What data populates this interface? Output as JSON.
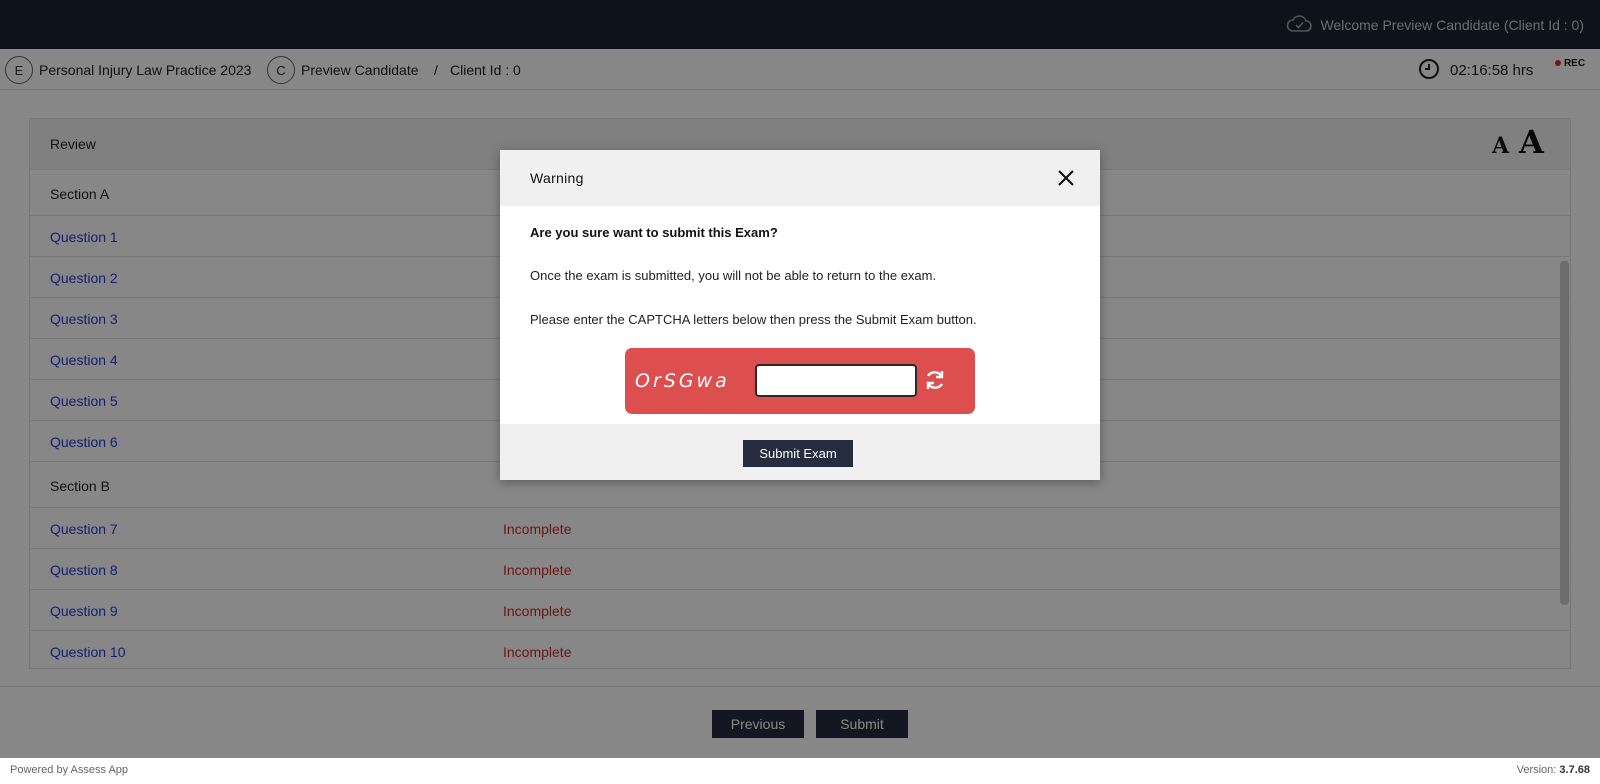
{
  "topbar": {
    "welcome": "Welcome Preview Candidate (Client Id : 0)"
  },
  "subbar": {
    "exam_badge": "E",
    "exam_name": "Personal Injury Law Practice 2023",
    "candidate_badge": "C",
    "candidate_name": "Preview Candidate",
    "separator": "/",
    "client_id": "Client Id : 0",
    "timer": "02:16:58 hrs",
    "rec_label": "REC"
  },
  "review": {
    "title": "Review",
    "font_small": "A",
    "font_large": "A",
    "rows": [
      {
        "type": "section",
        "label": "Section A"
      },
      {
        "type": "question",
        "label": "Question 1",
        "status": ""
      },
      {
        "type": "question",
        "label": "Question 2",
        "status": ""
      },
      {
        "type": "question",
        "label": "Question 3",
        "status": ""
      },
      {
        "type": "question",
        "label": "Question 4",
        "status": ""
      },
      {
        "type": "question",
        "label": "Question 5",
        "status": ""
      },
      {
        "type": "question",
        "label": "Question 6",
        "status": ""
      },
      {
        "type": "section",
        "label": "Section B"
      },
      {
        "type": "question",
        "label": "Question 7",
        "status": "Incomplete"
      },
      {
        "type": "question",
        "label": "Question 8",
        "status": "Incomplete"
      },
      {
        "type": "question",
        "label": "Question 9",
        "status": "Incomplete"
      },
      {
        "type": "question",
        "label": "Question 10",
        "status": "Incomplete"
      }
    ]
  },
  "nav": {
    "previous": "Previous",
    "submit": "Submit"
  },
  "footer": {
    "powered": "Powered by Assess App",
    "version_label": "Version:",
    "version": "3.7.68"
  },
  "modal": {
    "title": "Warning",
    "question": "Are you sure want to submit this Exam?",
    "info1": "Once the exam is submitted, you will not be able to return to the exam.",
    "info2": "Please enter the CAPTCHA letters below then press the Submit Exam button.",
    "captcha_code": "OrSGwa",
    "captcha_value": "",
    "submit_label": "Submit Exam"
  },
  "colors": {
    "topbar": "#1b2231",
    "button": "#262d3f",
    "captcha": "#dd4f4e",
    "question_link": "#2f3bd6",
    "incomplete": "#cc2b2b"
  }
}
